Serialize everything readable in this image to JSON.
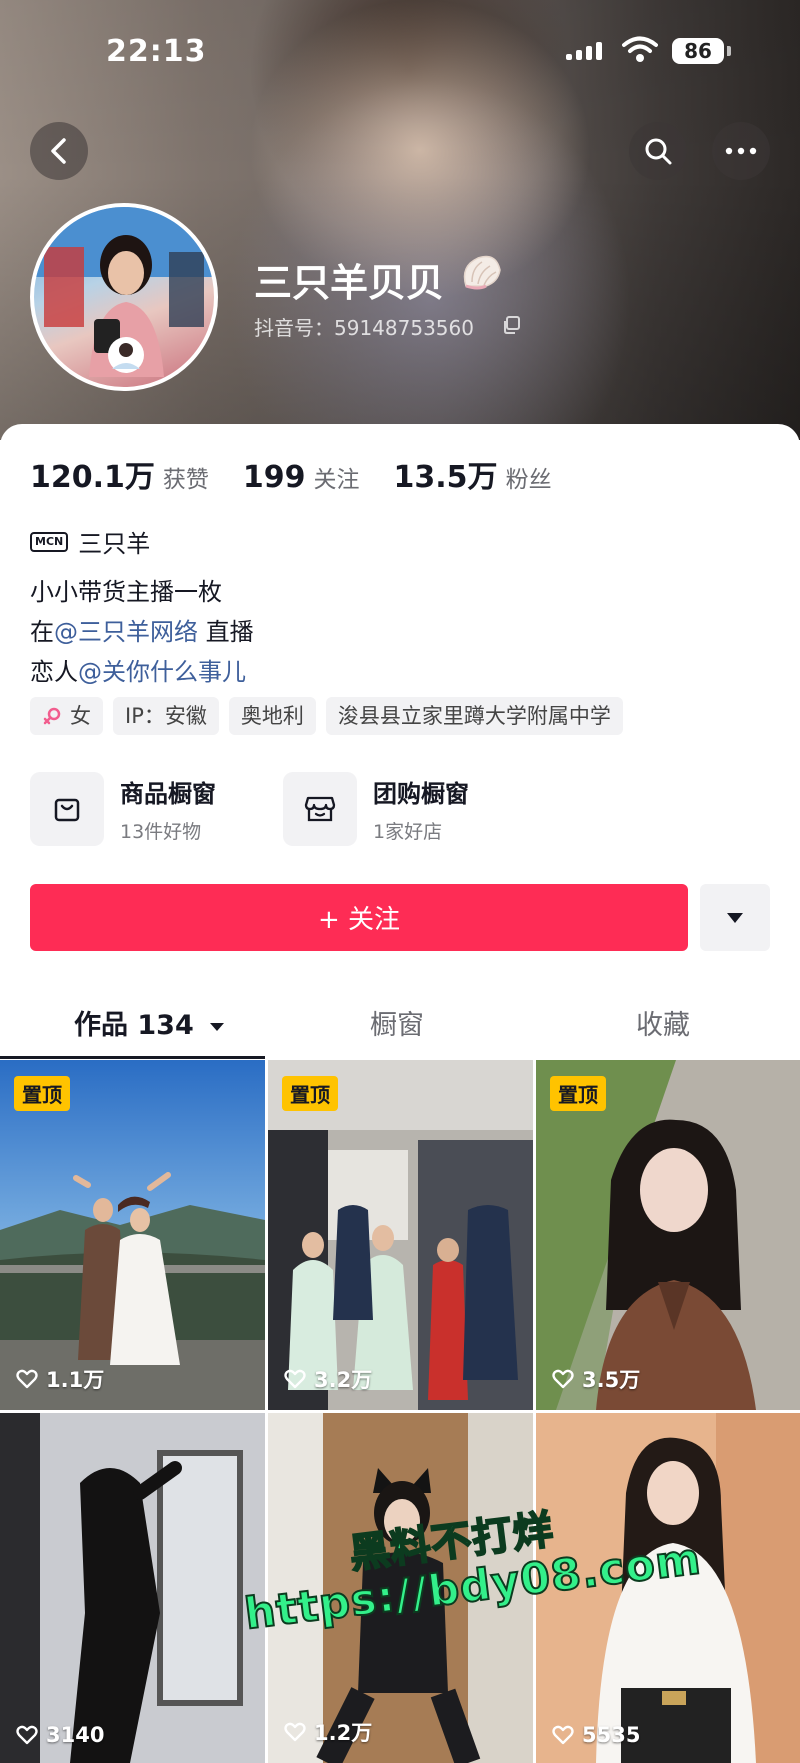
{
  "status_bar": {
    "time": "22:13",
    "battery": "86"
  },
  "profile": {
    "nickname": "三只羊贝贝",
    "douyin_id": "抖音号：59148753560"
  },
  "stats": [
    {
      "value": "120.1万",
      "label": "获赞"
    },
    {
      "value": "199",
      "label": "关注"
    },
    {
      "value": "13.5万",
      "label": "粉丝"
    }
  ],
  "mcn": {
    "badge": "MCN",
    "name": "三只羊"
  },
  "bio": {
    "line1": "小小带货主播一枚",
    "line2_prefix": "在",
    "line2_mention": "@三只羊网络",
    "line2_suffix": " 直播",
    "line3_prefix": "恋人",
    "line3_mention": "@关你什么事儿"
  },
  "tags": {
    "gender": "女",
    "ip": "IP：安徽",
    "country": "奥地利",
    "school": "浚县县立家里蹲大学附属中学"
  },
  "shops": [
    {
      "title": "商品橱窗",
      "subtitle": "13件好物"
    },
    {
      "title": "团购橱窗",
      "subtitle": "1家好店"
    }
  ],
  "follow_button": "+ 关注",
  "tabs": [
    "作品 134",
    "橱窗",
    "收藏"
  ],
  "videos": [
    {
      "pinned": "置顶",
      "likes": "1.1万"
    },
    {
      "pinned": "置顶",
      "likes": "3.2万"
    },
    {
      "pinned": "置顶",
      "likes": "3.5万"
    },
    {
      "likes": "3140"
    },
    {
      "likes": "1.2万"
    },
    {
      "likes": "5535"
    }
  ],
  "watermark": {
    "line1": "黑料不打烊",
    "line2": "https://bdy08.com"
  },
  "colors": {
    "accent": "#fe2c55",
    "mention": "#3e5f9b",
    "pin": "#ffc300",
    "watermark": "#33f08a"
  }
}
